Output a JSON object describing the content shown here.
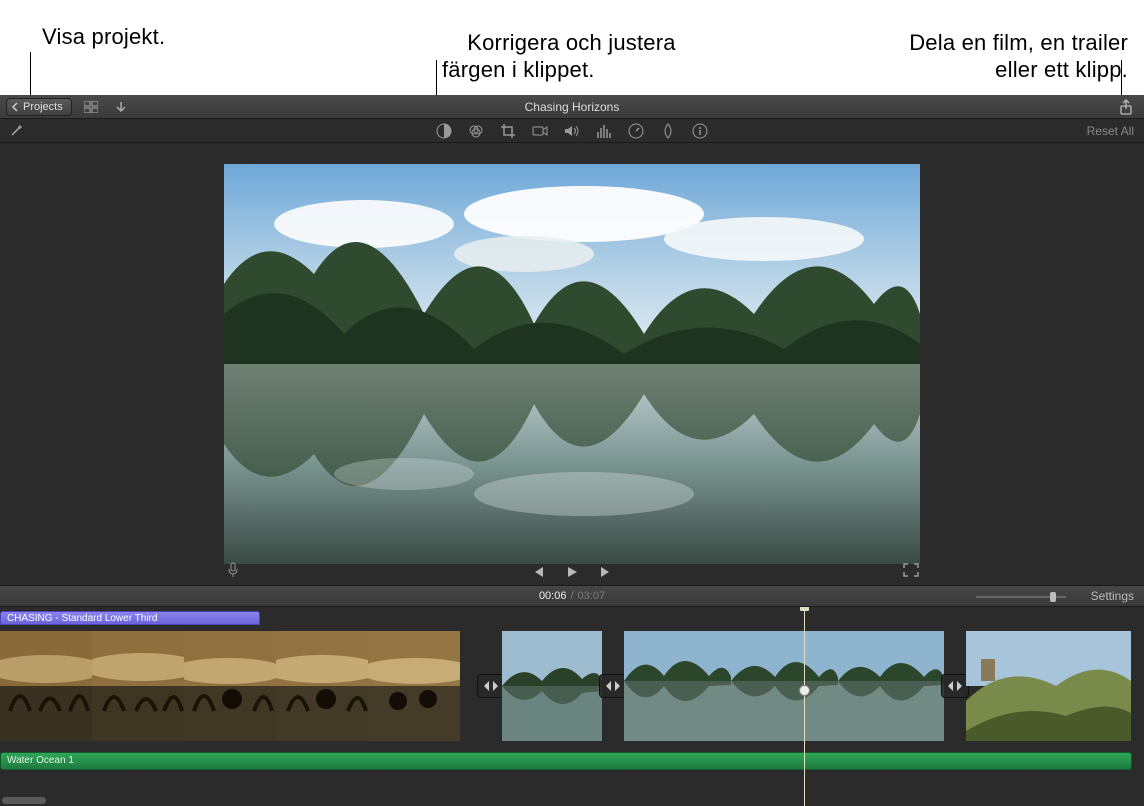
{
  "callouts": {
    "projects": "Visa projekt.",
    "color": "Korrigera och justera\nfärgen i klippet.",
    "share": "Dela en film, en trailer\neller ett klipp."
  },
  "topbar": {
    "projects_label": "Projects",
    "title": "Chasing Horizons"
  },
  "adjustbar": {
    "reset_label": "Reset All",
    "icons": {
      "wand": "magic-wand-icon",
      "color_balance": "color-balance-icon",
      "color_wheel": "color-wheel-icon",
      "crop": "crop-icon",
      "stabilize": "camera-icon",
      "volume": "volume-icon",
      "eq": "equalizer-icon",
      "speed": "speed-icon",
      "filter": "filter-drop-icon",
      "info": "info-icon"
    }
  },
  "viewer": {
    "mic": "microphone-icon",
    "prev": "previous-icon",
    "play": "play-icon",
    "next": "next-icon",
    "fullscreen": "fullscreen-icon"
  },
  "tlheader": {
    "current": "00:06",
    "sep": "/",
    "total": "03:07",
    "settings_label": "Settings"
  },
  "timeline": {
    "title_clip_label": "CHASING - Standard Lower Third",
    "audio_clip_label": "Water Ocean 1",
    "transition_icon": "crossfade-icon"
  }
}
